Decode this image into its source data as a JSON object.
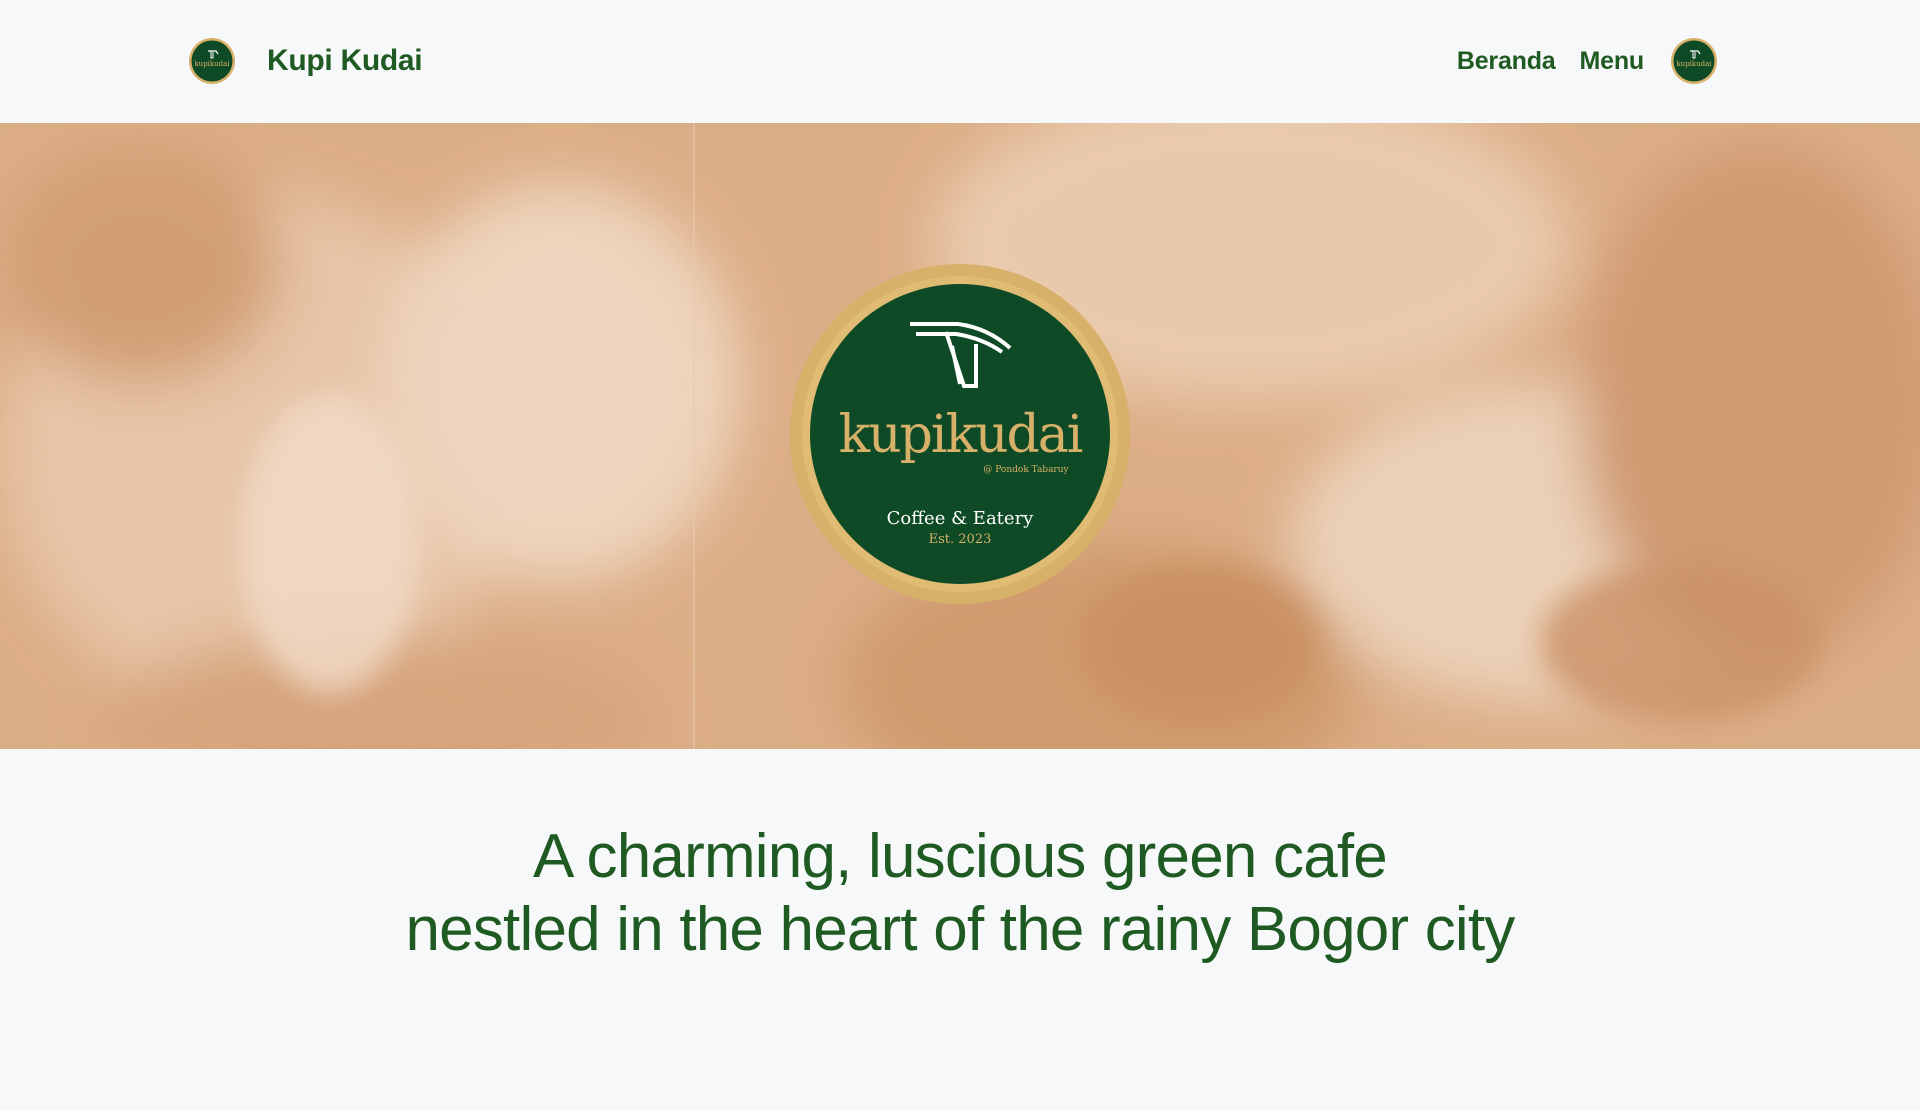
{
  "header": {
    "brand_name": "Kupi Kudai",
    "nav": [
      {
        "label": "Beranda"
      },
      {
        "label": "Menu"
      }
    ]
  },
  "logo": {
    "wordmark": "kupikudai",
    "sub": "@ Pondok Tabaruy",
    "line1": "Coffee & Eatery",
    "line2": "Est. 2023"
  },
  "hero": {
    "tagline_line1": "A charming, luscious green cafe",
    "tagline_line2": "nestled in the heart of the rainy Bogor city"
  },
  "colors": {
    "brand_green": "#1e5a22",
    "logo_green": "#0f4a26",
    "logo_ring": "#d7b069",
    "hero_bg": "#d9a982"
  }
}
